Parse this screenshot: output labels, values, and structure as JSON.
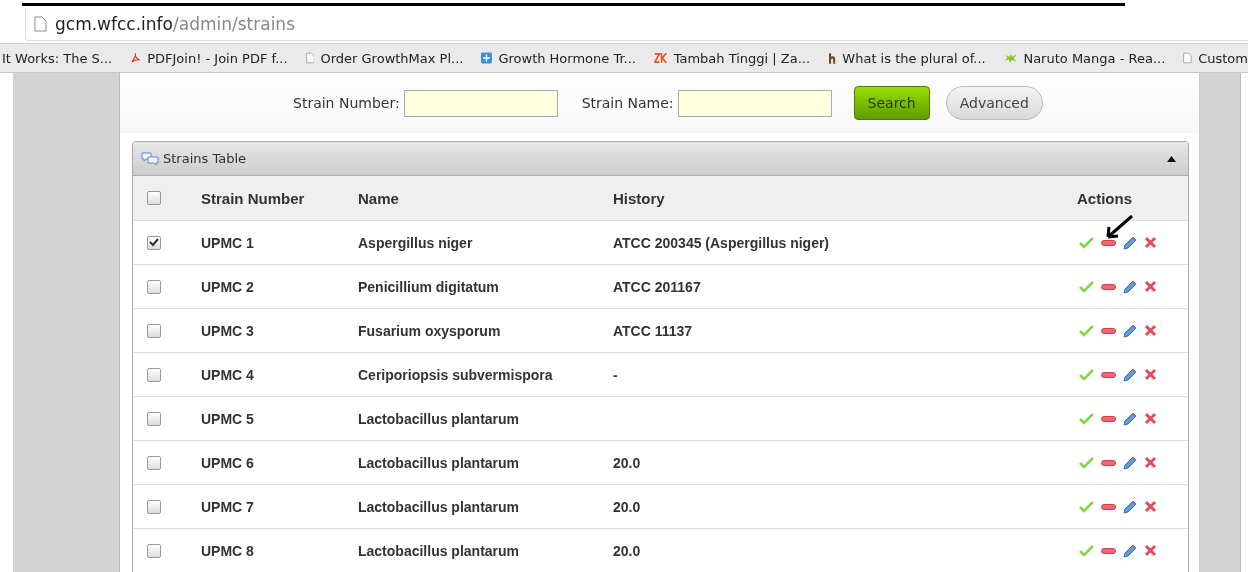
{
  "browser": {
    "url_host": "gcm.wfcc.info",
    "url_path": "/admin/strains"
  },
  "bookmarks": [
    {
      "label": "It Works: The S...",
      "kind": "none"
    },
    {
      "label": "PDFJoin! - Join PDF f...",
      "kind": "pdf"
    },
    {
      "label": "Order GrowthMax Pl...",
      "kind": "page"
    },
    {
      "label": "Growth Hormone Tr...",
      "kind": "plus"
    },
    {
      "label": "Tambah Tinggi | Za...",
      "kind": "zk"
    },
    {
      "label": "What is the plural of...",
      "kind": "h"
    },
    {
      "label": "Naruto Manga - Rea...",
      "kind": "splat"
    },
    {
      "label": "Custom",
      "kind": "page"
    }
  ],
  "search": {
    "number_label": "Strain Number:",
    "name_label": "Strain Name:",
    "search_button": "Search",
    "advanced_button": "Advanced"
  },
  "table": {
    "title": "Strains Table",
    "expanded": true,
    "select_all": {
      "checked": false
    },
    "columns": [
      "Strain Number",
      "Name",
      "History",
      "Actions"
    ],
    "rows": [
      {
        "number": "UPMC 1",
        "name": "Aspergillus niger",
        "history": "ATCC 200345 (Aspergillus niger)",
        "checked": true
      },
      {
        "number": "UPMC 2",
        "name": "Penicillium digitatum",
        "history": "ATCC 201167",
        "checked": false
      },
      {
        "number": "UPMC 3",
        "name": "Fusarium oxysporum",
        "history": "ATCC 11137",
        "checked": false
      },
      {
        "number": "UPMC 4",
        "name": "Ceriporiopsis subvermispora",
        "history": "-",
        "checked": false
      },
      {
        "number": "UPMC 5",
        "name": "Lactobacillus plantarum",
        "checked": false
      },
      {
        "number": "UPMC 6",
        "name": "Lactobacillus plantarum",
        "history": "20.0",
        "checked": false
      },
      {
        "number": "UPMC 7",
        "name": "Lactobacillus plantarum",
        "history": "20.0",
        "checked": false
      },
      {
        "number": "UPMC 8",
        "name": "Lactobacillus plantarum",
        "history": "20.0",
        "checked": false
      }
    ]
  }
}
